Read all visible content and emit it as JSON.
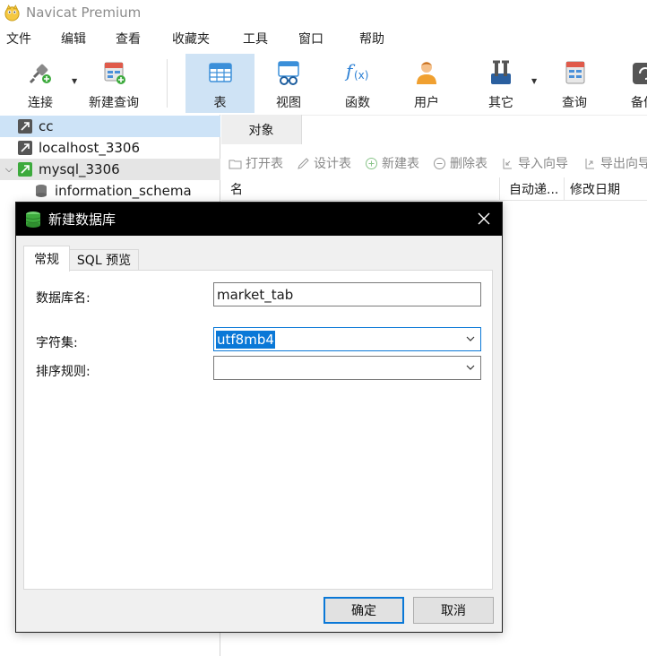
{
  "window": {
    "title": "Navicat Premium"
  },
  "menu": [
    "文件",
    "编辑",
    "查看",
    "收藏夹",
    "工具",
    "窗口",
    "帮助"
  ],
  "toolbar": {
    "connect": "连接",
    "new_query": "新建查询",
    "table": "表",
    "view": "视图",
    "function": "函数",
    "user": "用户",
    "other": "其它",
    "query": "查询",
    "backup": "备份"
  },
  "tree": {
    "items": [
      {
        "label": "cc"
      },
      {
        "label": "localhost_3306"
      },
      {
        "label": "mysql_3306"
      },
      {
        "label": "information_schema"
      }
    ]
  },
  "objects": {
    "tab_label": "对象",
    "actions": [
      "打开表",
      "设计表",
      "新建表",
      "删除表",
      "导入向导",
      "导出向导"
    ],
    "columns": [
      "名",
      "自动递...",
      "修改日期"
    ]
  },
  "dialog": {
    "title": "新建数据库",
    "tabs": [
      "常规",
      "SQL 预览"
    ],
    "fields": {
      "db_name_label": "数据库名:",
      "db_name_value": "market_tab",
      "charset_label": "字符集:",
      "charset_value": "utf8mb4",
      "collation_label": "排序规则:",
      "collation_value": ""
    },
    "ok_label": "确定",
    "cancel_label": "取消"
  },
  "colors": {
    "accent": "#0a78d7",
    "selection": "#cde3f7",
    "toolbar_active": "#cfe3f5",
    "dialog_titlebar": "#000000",
    "mysql_green": "#3daa3d"
  }
}
